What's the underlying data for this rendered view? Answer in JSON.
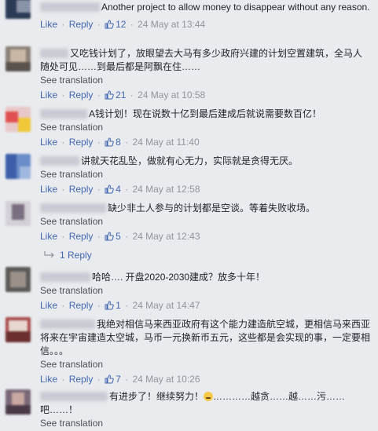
{
  "labels": {
    "like": "Like",
    "reply": "Reply",
    "see_translation": "See translation",
    "separator": "·"
  },
  "comments": [
    {
      "text": "Another project to allow money to disappear without any reason.",
      "likes": "12",
      "timestamp": "24 May at 13:44",
      "has_translation": false
    },
    {
      "text": "又吃钱计划了，放眼望去大马有多少政府兴建的计划空置建筑，全马人随处可见……到最后都是阿飘在住……",
      "likes": "21",
      "timestamp": "24 May at 10:58",
      "has_translation": true
    },
    {
      "text": "A钱计划！现在说数十亿到最后建成后就说需要数百亿！",
      "likes": "8",
      "timestamp": "24 May at 11:40",
      "has_translation": true
    },
    {
      "text": "讲就天花乱坠，做就有心无力，实际就是贪得无厌。",
      "likes": "4",
      "timestamp": "24 May at 12:58",
      "has_translation": true
    },
    {
      "text": "缺少非土人参与的计划都是空谈。等着失败收场。",
      "likes": "5",
      "timestamp": "24 May at 12:43",
      "has_translation": true,
      "replies_label": "1 Reply"
    },
    {
      "text": "哈哈…. 开盘2020-2030建成？放多十年！",
      "likes": "1",
      "timestamp": "24 May at 14:47",
      "has_translation": true
    },
    {
      "text": "我绝对相信马来西亚政府有这个能力建造航空城，更相信马来西亚将来在宇宙建造太空城，马币一元换新币五元，这些都是会实现的事，一定要相信。。。",
      "likes": "7",
      "timestamp": "24 May at 10:26",
      "has_translation": true
    },
    {
      "text_before": "有进步了！继续努力！",
      "text_after": "…………越贪……越……污……吧……！",
      "emoji": "grimacing-face",
      "has_translation": true
    }
  ],
  "colors": {
    "link": "#4267b2",
    "meta": "#90949c",
    "background": "#e9ebee"
  }
}
